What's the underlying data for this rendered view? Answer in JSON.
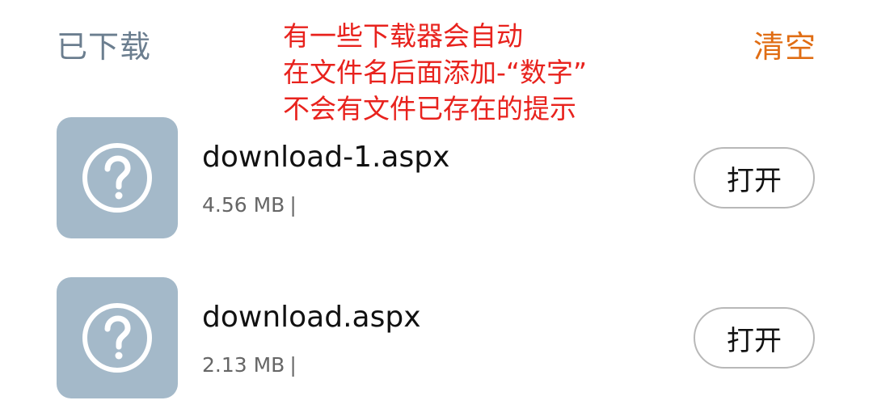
{
  "header": {
    "title": "已下载",
    "clear_label": "清空"
  },
  "annotation": {
    "lines": [
      "有一些下载器会自动",
      "在文件名后面添加-“数字”",
      "不会有文件已存在的提示"
    ],
    "color": "#e8221d"
  },
  "downloads": [
    {
      "filename": "download-1.aspx",
      "size": "4.56 MB",
      "separator": "|",
      "icon": "question-mark-icon",
      "open_label": "打开"
    },
    {
      "filename": "download.aspx",
      "size": "2.13 MB",
      "separator": "|",
      "icon": "question-mark-icon",
      "open_label": "打开"
    }
  ],
  "colors": {
    "title": "#6b7e8f",
    "accent": "#e06d14",
    "thumbnail": "#a4b9c9"
  }
}
